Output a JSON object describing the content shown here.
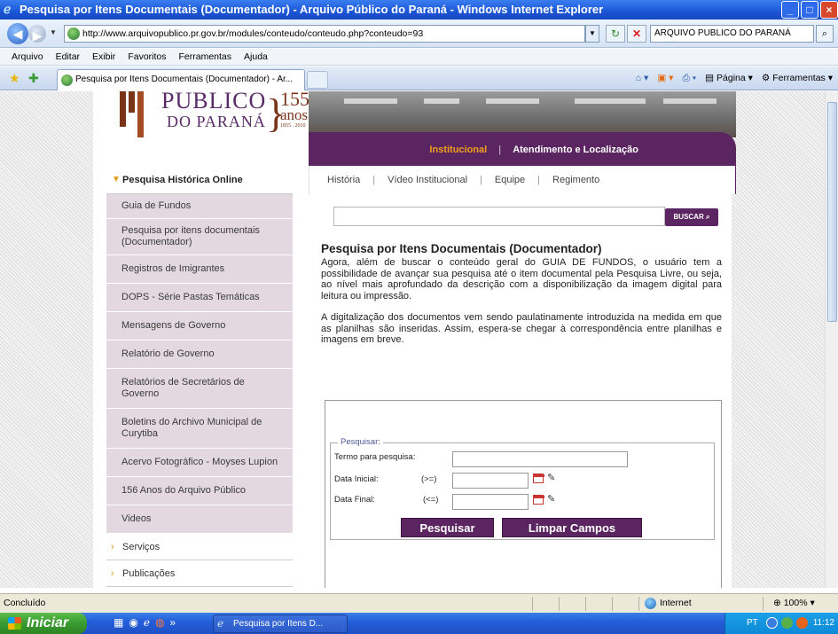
{
  "window": {
    "title": "Pesquisa por Itens Documentais (Documentador) - Arquivo Público do Paraná - Windows Internet Explorer",
    "controls": [
      "_",
      "□",
      "×"
    ]
  },
  "addressbar": {
    "url": "http://www.arquivopublico.pr.gov.br/modules/conteudo/conteudo.php?conteudo=93",
    "search_value": "ARQUIVO PUBLICO DO PARANÁ"
  },
  "menubar": {
    "items": [
      "Arquivo",
      "Editar",
      "Exibir",
      "Favoritos",
      "Ferramentas",
      "Ajuda"
    ]
  },
  "tabs": {
    "active_label": "Pesquisa por Itens Documentais (Documentador) - Ar...",
    "commands": [
      "Página",
      "Ferramentas"
    ]
  },
  "logo": {
    "line1": "PÚBLICO",
    "line2": "DO PARANÁ",
    "number": "155",
    "anos": "anos",
    "years": "1855 . 2010"
  },
  "topnav": {
    "active": "Institucional",
    "separator": "|",
    "other": "Atendimento e Localização"
  },
  "subnav": {
    "items": [
      "História",
      "Vídeo Institucional",
      "Equipe",
      "Regimento"
    ],
    "separator": "|"
  },
  "sidebar": {
    "header": "Pesquisa Histórica Online",
    "items": [
      "Guia de Fundos",
      "Pesquisa por itens documentais (Documentador)",
      "Registros de Imigrantes",
      "DOPS - Série Pastas Temáticas",
      "Mensagens de Governo",
      "Relatório de Governo",
      "Relatórios de Secretários de Governo",
      "Boletins do Archivo Municipal de Curytiba",
      "Acervo Fotográfico - Moyses Lupion",
      "156 Anos do Arquivo Público",
      "Videos"
    ],
    "footer": [
      "Serviços",
      "Publicações"
    ]
  },
  "search": {
    "button_label": "BUSCAR",
    "value": ""
  },
  "article": {
    "title": "Pesquisa por Itens Documentais (Documentador)",
    "p1": "Agora, além de buscar o conteúdo geral do GUIA DE FUNDOS, o usuário tem a possibilidade de avançar sua pesquisa até o item documental pela Pesquisa Livre, ou seja, ao nível mais aprofundado da descrição com a disponibilização da imagem digital para leitura ou impressão.",
    "p2": "A digitalização dos documentos vem sendo paulatinamente introduzida na medida em que as planilhas são inseridas. Assim, espera-se chegar à correspondência entre planilhas e imagens em breve."
  },
  "form": {
    "legend": "Pesquisar:",
    "term_label": "Termo para pesquisa:",
    "start_label": "Data Inicial:",
    "start_op": "(>=)",
    "end_label": "Data Final:",
    "end_op": "(<=)",
    "submit_label": "Pesquisar",
    "clear_label": "Limpar Campos"
  },
  "statusbar": {
    "text": "Concluído",
    "zone": "Internet",
    "zoom": "100%"
  },
  "taskbar": {
    "start_label": "Iniciar",
    "task_label": "Pesquisa por Itens D...",
    "lang": "PT",
    "clock": "11:12"
  },
  "colors": {
    "purple": "#5a2560",
    "sidebar_item_bg": "#e3d8df",
    "orange_accent": "#f0a019"
  }
}
